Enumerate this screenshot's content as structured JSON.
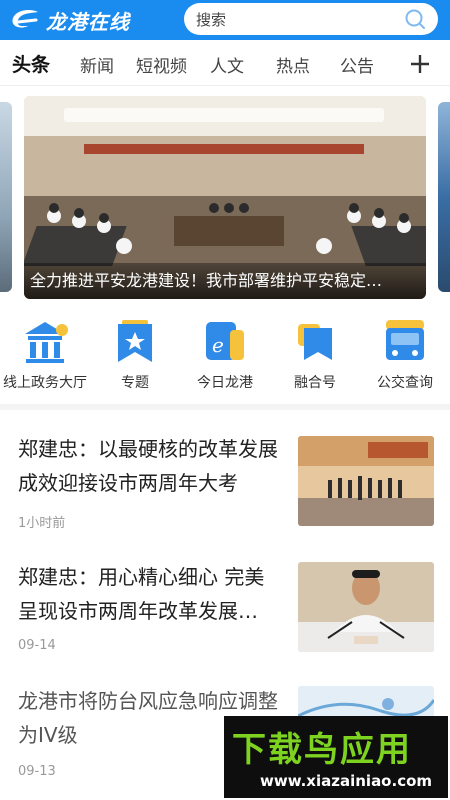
{
  "header": {
    "logo_text": "龙港在线",
    "search_placeholder": "搜索"
  },
  "tabs": [
    {
      "label": "头条",
      "active": true
    },
    {
      "label": "新闻",
      "active": false
    },
    {
      "label": "短视频",
      "active": false
    },
    {
      "label": "人文",
      "active": false
    },
    {
      "label": "热点",
      "active": false
    },
    {
      "label": "公告",
      "active": false
    }
  ],
  "banner": {
    "caption": "全力推进平安龙港建设！我市部署维护平安稳定…"
  },
  "quick_nav": [
    {
      "label": "线上政务大厅",
      "icon": "government-building-icon"
    },
    {
      "label": "专题",
      "icon": "bookmark-star-icon"
    },
    {
      "label": "今日龙港",
      "icon": "ie-browser-icon"
    },
    {
      "label": "融合号",
      "icon": "folded-bookmark-icon"
    },
    {
      "label": "公交查询",
      "icon": "bus-icon"
    }
  ],
  "news": [
    {
      "title": "郑建忠：以最硬核的改革发展成效迎接设市两周年大考",
      "meta": "1小时前"
    },
    {
      "title": "郑建忠：用心精心细心 完美呈现设市两周年改革发展…",
      "meta": "09-14"
    },
    {
      "title": "龙港市将防台风应急响应调整为IV级",
      "meta": "09-13"
    }
  ],
  "watermark": {
    "main": "下载鸟应用",
    "url": "www.xiazainiao.com"
  },
  "colors": {
    "brand_blue": "#1a8cf0",
    "watermark_green": "#7ed321"
  }
}
